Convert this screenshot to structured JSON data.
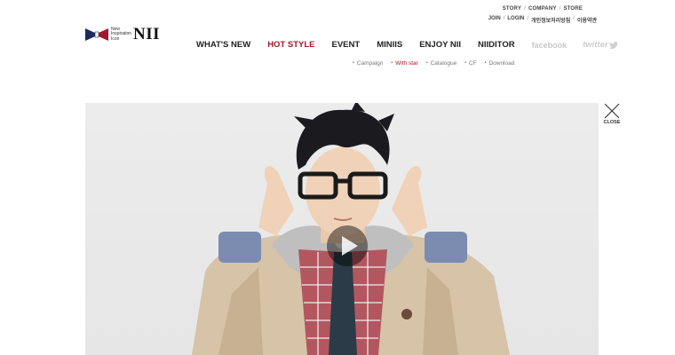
{
  "utility": {
    "links": [
      "STORY",
      "COMPANY",
      "STORE"
    ],
    "sub_links": [
      "JOIN",
      "LOGIN",
      "개인정보처리방침",
      "이용약관"
    ],
    "separator": "/"
  },
  "logo": {
    "tagline_1": "New",
    "tagline_2": "Inspiration",
    "tagline_3": "Icon",
    "wordmark": "NII"
  },
  "gnb": {
    "items": [
      {
        "label": "WHAT'S NEW",
        "active": false
      },
      {
        "label": "HOT STYLE",
        "active": true
      },
      {
        "label": "EVENT",
        "active": false
      },
      {
        "label": "MINIIS",
        "active": false
      },
      {
        "label": "ENJOY NII",
        "active": false
      },
      {
        "label": "NIIDITOR",
        "active": false
      }
    ],
    "facebook": "facebook",
    "twitter": "twitter"
  },
  "lnb": {
    "items": [
      {
        "label": "Campaign",
        "active": false
      },
      {
        "label": "With star",
        "active": true
      },
      {
        "label": "Catalogue",
        "active": false
      },
      {
        "label": "CF",
        "active": false
      },
      {
        "label": "Download",
        "active": false
      }
    ]
  },
  "video": {
    "play_icon": "play-icon"
  },
  "close": {
    "label": "CLOSE",
    "icon": "close-icon"
  },
  "colors": {
    "brand_red": "#a0182b",
    "brand_navy": "#1d2a5c",
    "inactive_social": "#c8c8c8"
  }
}
